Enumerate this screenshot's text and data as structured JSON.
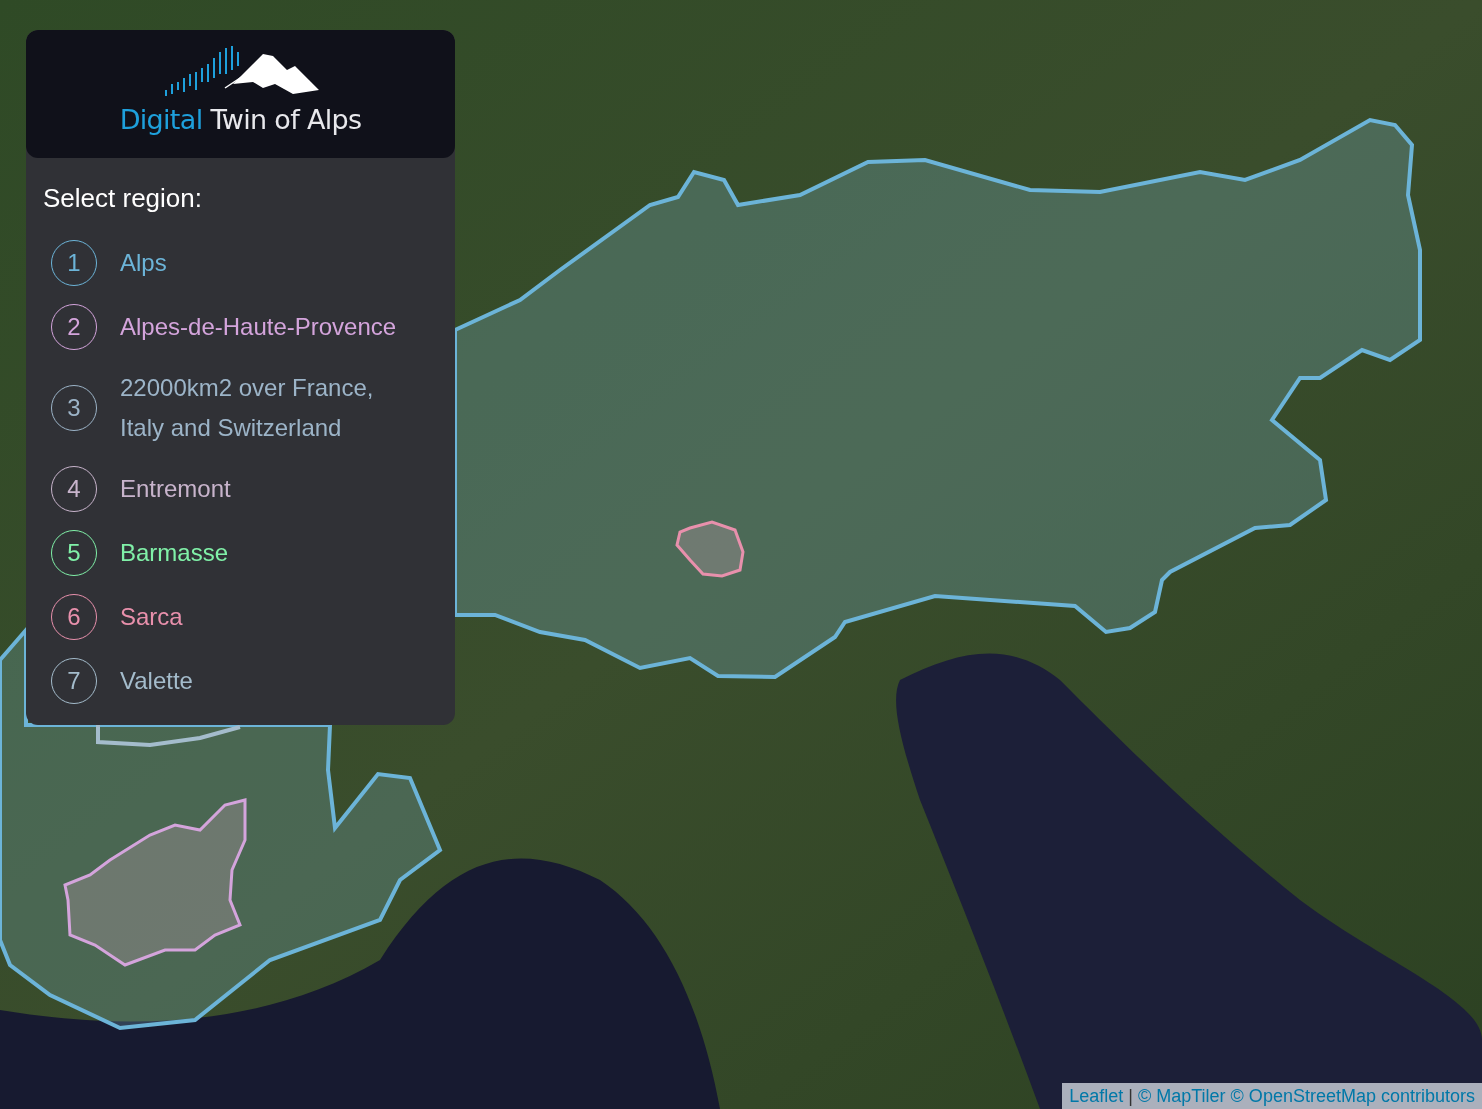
{
  "logo": {
    "parts": [
      {
        "text": "Digital",
        "kind": "accent"
      },
      {
        "text": "Twin of Alps",
        "kind": "plain"
      }
    ]
  },
  "panel": {
    "heading": "Select region:"
  },
  "regions": [
    {
      "number": "1",
      "name": "Alps",
      "color": "#6cb4d8"
    },
    {
      "number": "2",
      "name": "Alpes-de-Haute-Provence",
      "color": "#d4a4dc"
    },
    {
      "number": "3",
      "name": "22000km2 over France, Italy and Switzerland",
      "color": "#9cb4c8"
    },
    {
      "number": "4",
      "name": "Entremont",
      "color": "#c8b4cc"
    },
    {
      "number": "5",
      "name": "Barmasse",
      "color": "#80f0a8"
    },
    {
      "number": "6",
      "name": "Sarca",
      "color": "#e890ac"
    },
    {
      "number": "7",
      "name": "Valette",
      "color": "#a4bccc"
    }
  ],
  "attribution": {
    "links": [
      "Leaflet",
      "© MapTiler © OpenStreetMap contributors"
    ],
    "separator": "|"
  }
}
